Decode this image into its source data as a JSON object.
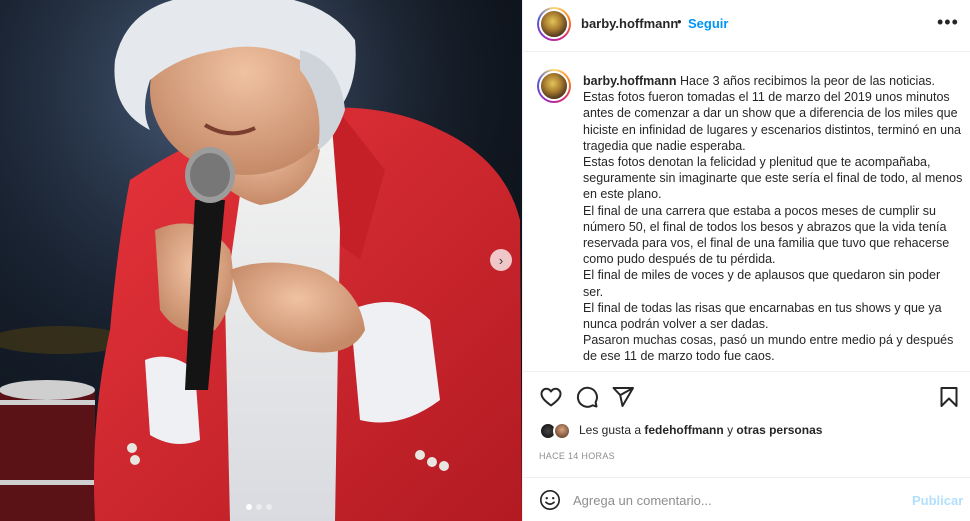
{
  "post": {
    "username": "barby.hoffmann",
    "separator": "•",
    "follow_label": "Seguir",
    "more_label": "•••"
  },
  "caption": {
    "username": "barby.hoffmann",
    "paragraphs": [
      "Hace 3 años recibimos la peor de las noticias.",
      "Estas fotos fueron tomadas el 11 de marzo del 2019 unos minutos antes de comenzar a dar un show que a diferencia de los miles que hiciste en infinidad de lugares y escenarios distintos, terminó en una tragedia que nadie esperaba.",
      "Estas fotos denotan la felicidad y plenitud que te acompañaba, seguramente sin imaginarte que este sería el final de todo, al menos en este plano.",
      "El final de una carrera que estaba a pocos meses de cumplir su número 50, el final de todos los besos y abrazos que la vida tenía reservada para vos, el final de una familia que tuvo que rehacerse como pudo después de tu pérdida.",
      "El final de miles de voces y de aplausos que quedaron sin poder ser.",
      "El final de todas las risas que encarnabas en tus shows y que ya nunca podrán volver a ser dadas.",
      "Pasaron muchas cosas, pasó un mundo entre medio pá y después de ese 11 de marzo todo fue caos."
    ]
  },
  "likes": {
    "prefix": "Les gusta a ",
    "user": "fedehoffmann",
    "middle": " y ",
    "others": "otras personas"
  },
  "timestamp": "HACE 14 HORAS",
  "comment": {
    "placeholder": "Agrega un comentario...",
    "publish_label": "Publicar"
  },
  "icons": {
    "heart": "heart-icon",
    "comment": "comment-icon",
    "share": "share-icon",
    "save": "bookmark-icon",
    "emoji": "emoji-icon",
    "next": "chevron-right-icon"
  },
  "carousel": {
    "total_dots": 3,
    "active_index": 0
  },
  "colors": {
    "accent": "#0095f6",
    "publish_disabled": "#b2dffc",
    "jacket": "#d8262e"
  }
}
